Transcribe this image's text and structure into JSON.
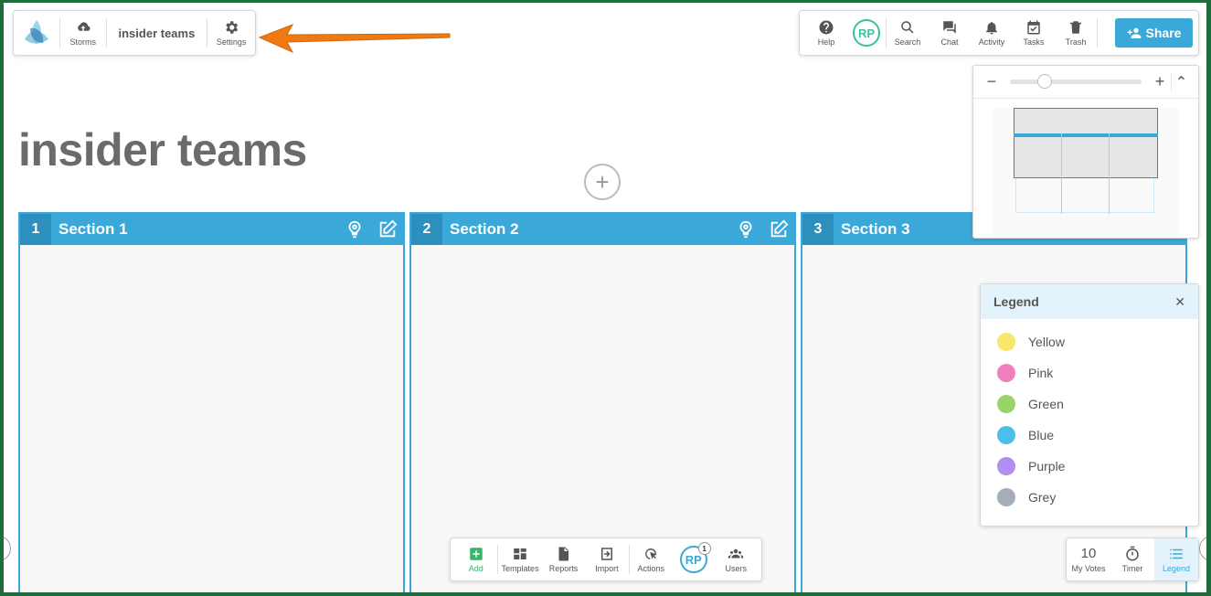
{
  "top_left": {
    "storms_label": "Storms",
    "board_name": "insider teams",
    "settings_label": "Settings"
  },
  "top_right": {
    "help_label": "Help",
    "avatar_initials": "RP",
    "search_label": "Search",
    "chat_label": "Chat",
    "activity_label": "Activity",
    "tasks_label": "Tasks",
    "trash_label": "Trash",
    "share_label": "Share"
  },
  "board": {
    "title": "insider teams",
    "add_symbol": "+"
  },
  "sections": [
    {
      "number": "1",
      "name": "Section 1"
    },
    {
      "number": "2",
      "name": "Section 2"
    },
    {
      "number": "3",
      "name": "Section 3"
    }
  ],
  "minimap": {
    "zoom_out_symbol": "−",
    "zoom_in_symbol": "+",
    "collapse_symbol": "⌃",
    "zoom_level": 0.2
  },
  "legend": {
    "title": "Legend",
    "close_symbol": "✕",
    "items": [
      {
        "label": "Yellow",
        "color": "#f8e86a"
      },
      {
        "label": "Pink",
        "color": "#f07fbf"
      },
      {
        "label": "Green",
        "color": "#9bd36b"
      },
      {
        "label": "Blue",
        "color": "#4bbfe8"
      },
      {
        "label": "Purple",
        "color": "#b28ef0"
      },
      {
        "label": "Grey",
        "color": "#a4adb8"
      }
    ]
  },
  "bottom_toolbar": {
    "add_label": "Add",
    "templates_label": "Templates",
    "reports_label": "Reports",
    "import_label": "Import",
    "actions_label": "Actions",
    "avatar_initials": "RP",
    "avatar_badge": "1",
    "users_label": "Users"
  },
  "bottom_right": {
    "votes_count": "10",
    "votes_label": "My Votes",
    "timer_label": "Timer",
    "legend_label": "Legend"
  },
  "colors": {
    "accent": "#3aa8d8",
    "share": "#3aa8d8",
    "arrow": "#f07a12",
    "avatar": "#3cc1a0"
  }
}
